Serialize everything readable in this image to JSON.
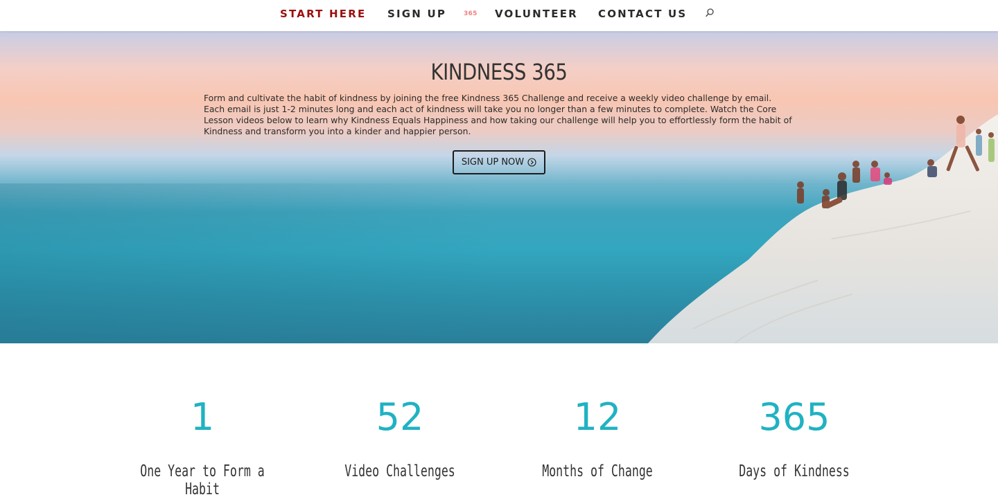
{
  "nav": {
    "items": [
      {
        "label": "START HERE",
        "active": true
      },
      {
        "label": "SIGN UP"
      },
      {
        "label": "365"
      },
      {
        "label": "VOLUNTEER"
      },
      {
        "label": "CONTACT US"
      }
    ],
    "search_icon": "search-icon",
    "active_color": "#9b0e0e",
    "badge_color": "#f08080"
  },
  "hero": {
    "title": "KINDNESS 365",
    "description": "Form and cultivate the habit of kindness by joining the free Kindness 365 Challenge and receive a weekly video challenge by email. Each email is just 1-2 minutes long and each act of kindness will take you no longer than a few minutes to complete. Watch the Core Lesson videos below to learn why Kindness Equals Happiness and how taking our challenge will help you to effortlessly form the habit of Kindness and transform you into a kinder and happier person.",
    "button_label": "SIGN UP NOW",
    "button_icon": "circle-arrow-right-icon"
  },
  "counters": [
    {
      "number": "1",
      "label": "One Year to Form a Habit"
    },
    {
      "number": "52",
      "label": "Video Challenges"
    },
    {
      "number": "12",
      "label": "Months of Change"
    },
    {
      "number": "365",
      "label": "Days of Kindness"
    }
  ],
  "colors": {
    "accent": "#20b2c2",
    "text": "#333333"
  }
}
